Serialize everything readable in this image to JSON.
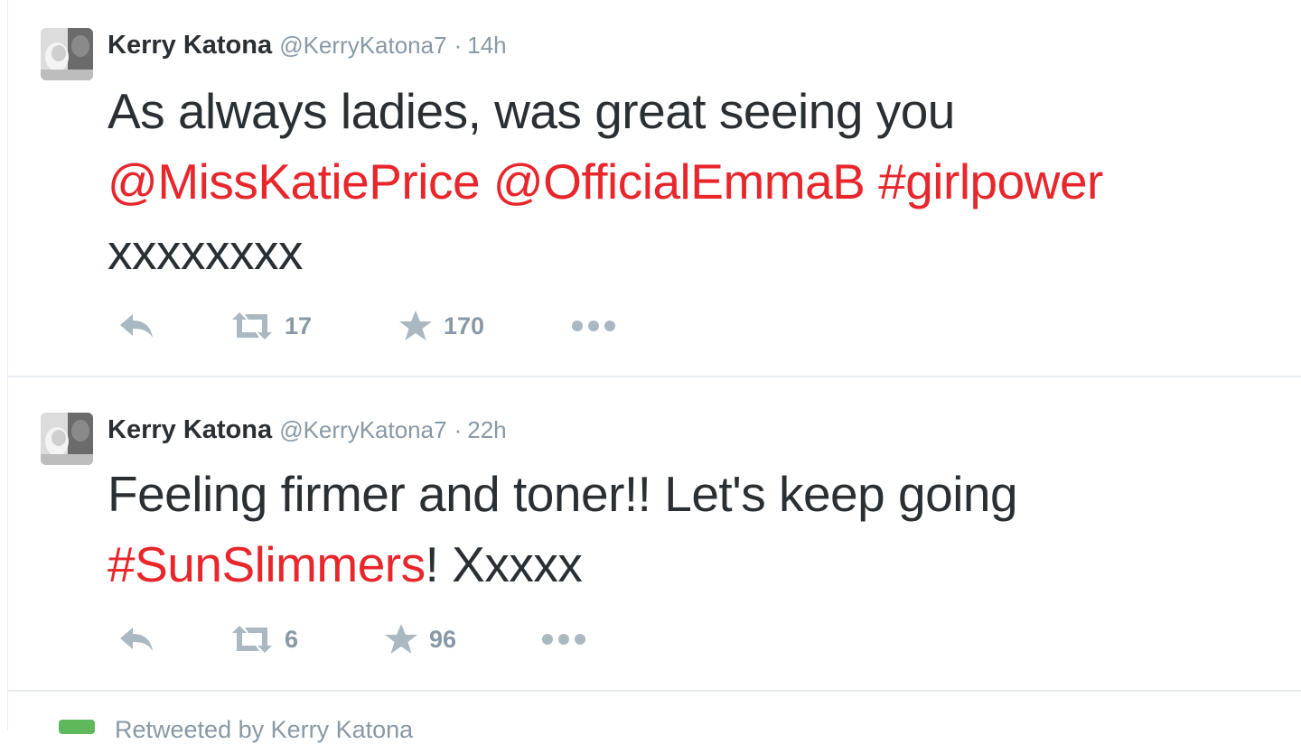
{
  "tweets": [
    {
      "author_name": "Kerry Katona",
      "handle": "@KerryKatona7",
      "separator": "·",
      "time": "14h",
      "text_line1": "As always ladies, was great seeing you",
      "mention1": "@MissKatiePrice",
      "mention2": "@OfficialEmmaB",
      "hashtag": "#girlpower",
      "text_line3": "xxxxxxxx",
      "retweets": "17",
      "favorites": "170",
      "icons": [
        "reply-icon",
        "retweet-icon",
        "star-icon",
        "more-icon"
      ]
    },
    {
      "author_name": "Kerry Katona",
      "handle": "@KerryKatona7",
      "separator": "·",
      "time": "22h",
      "text_line1": "Feeling firmer and toner!! Let's keep going",
      "hashtag": "#SunSlimmers",
      "text_after_hashtag": "! Xxxxx",
      "retweets": "6",
      "favorites": "96",
      "icons": [
        "reply-icon",
        "retweet-icon",
        "star-icon",
        "more-icon"
      ]
    }
  ],
  "next_item": {
    "label": "Retweeted by Kerry Katona"
  },
  "colors": {
    "link": "#e8262b",
    "meta_gray": "#8899a6",
    "icon_gray": "#aab8c2",
    "text": "#292f33",
    "divider": "#e6ecf0",
    "retweet_badge": "#5fb85c"
  }
}
